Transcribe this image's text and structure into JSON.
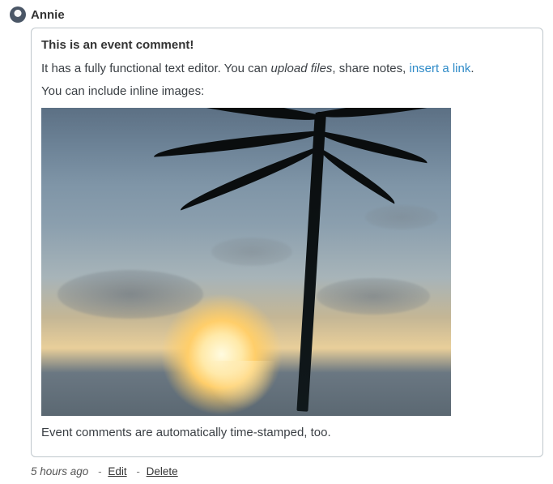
{
  "author": {
    "name": "Annie"
  },
  "comment": {
    "title_line": "This is an event comment!",
    "line2_pre": "It has a fully functional text editor. You can ",
    "line2_em": "upload files",
    "line2_mid": ", share notes, ",
    "line2_link": "insert a link",
    "line2_post": ".",
    "image_intro": "You can include inline images:",
    "footer": "Event comments are automatically time-stamped, too."
  },
  "meta": {
    "timestamp": "5 hours ago",
    "edit_label": "Edit",
    "delete_label": "Delete"
  }
}
